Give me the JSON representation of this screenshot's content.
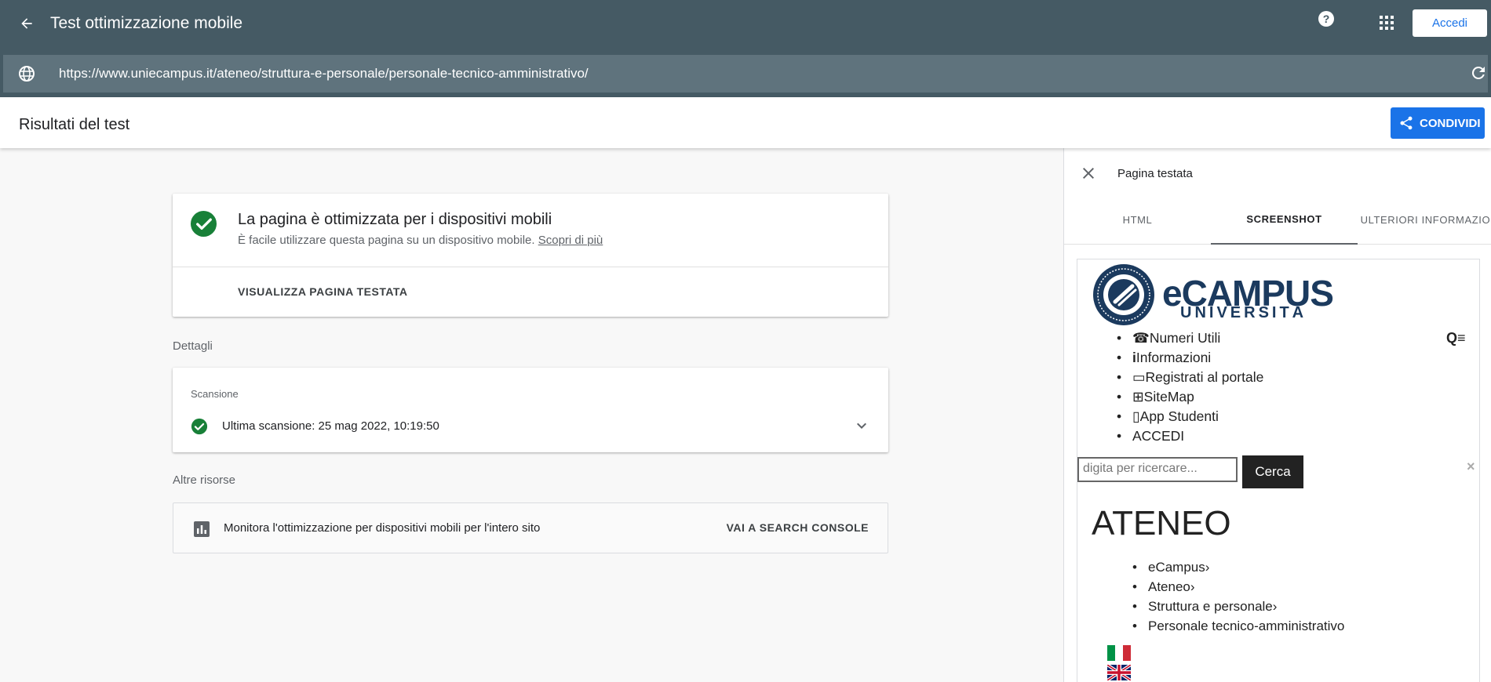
{
  "appbar": {
    "title": "Test ottimizzazione mobile",
    "signin_label": "Accedi",
    "url": "https://www.uniecampus.it/ateneo/struttura-e-personale/personale-tecnico-amministrativo/"
  },
  "results": {
    "title": "Risultati del test",
    "share_label": "CONDIVIDI"
  },
  "result_card": {
    "title": "La pagina è ottimizzata per i dispositivi mobili",
    "subtitle": "È facile utilizzare questa pagina su un dispositivo mobile.",
    "learn_more": "Scopri di più",
    "view_page": "VISUALIZZA PAGINA TESTATA"
  },
  "details": {
    "label": "Dettagli",
    "scan_label": "Scansione",
    "scan_text": "Ultima scansione: 25 mag 2022, 10:19:50"
  },
  "resources": {
    "label": "Altre risorse",
    "text": "Monitora l'ottimizzazione per dispositivi mobili per l'intero sito",
    "link": "VAI A SEARCH CONSOLE"
  },
  "side_panel": {
    "title": "Pagina testata",
    "tabs": [
      {
        "label": "HTML"
      },
      {
        "label": "SCREENSHOT"
      },
      {
        "label": "ULTERIORI INFORMAZIONI"
      }
    ]
  },
  "preview": {
    "logo_word": "eCAMPUS",
    "logo_sub": "UNIVERSITÀ",
    "menu": [
      "Numeri Utili",
      "Informazioni",
      "Registrati al portale",
      "SiteMap",
      "App Studenti",
      "ACCEDI"
    ],
    "search_placeholder": "digita per ricercare...",
    "search_button": "Cerca",
    "heading": "ATENEO",
    "breadcrumb": [
      "eCampus",
      "Ateneo",
      "Struttura e personale",
      "Personale tecnico-amministrativo"
    ]
  },
  "colors": {
    "appbar": "#455a64",
    "urlbar": "#5f737d",
    "accent": "#1a73e8",
    "success": "#188038"
  }
}
